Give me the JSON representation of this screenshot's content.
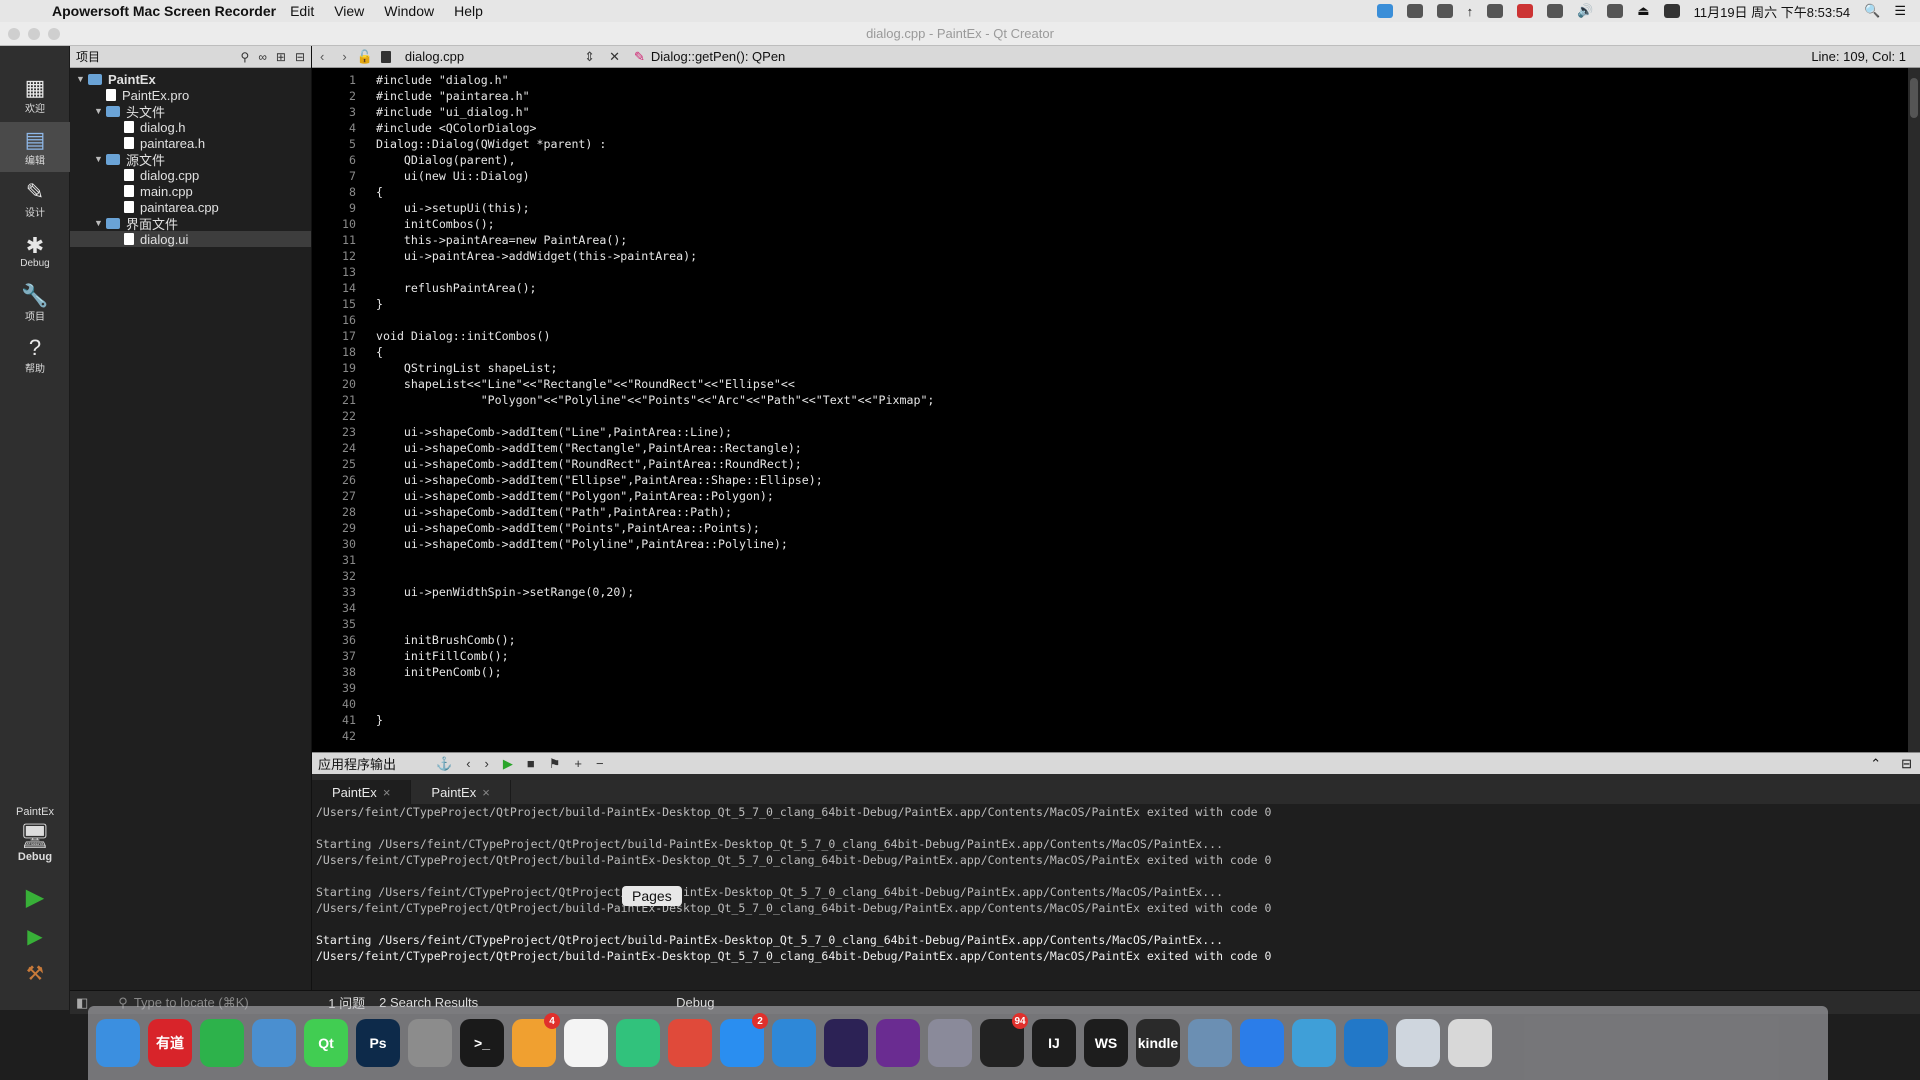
{
  "menubar": {
    "app_name": "Apowersoft Mac Screen Recorder",
    "items": [
      "Edit",
      "View",
      "Window",
      "Help"
    ],
    "clock": "11月19日 周六 下午8:53:54"
  },
  "window": {
    "title": "dialog.cpp - PaintEx - Qt Creator"
  },
  "modes": [
    {
      "label": "欢迎",
      "icon": "grid-icon"
    },
    {
      "label": "编辑",
      "icon": "document-icon"
    },
    {
      "label": "设计",
      "icon": "pencil-icon"
    },
    {
      "label": "Debug",
      "icon": "bug-icon"
    },
    {
      "label": "项目",
      "icon": "wrench-icon"
    },
    {
      "label": "帮助",
      "icon": "question-icon"
    }
  ],
  "project_panel": {
    "header": "项目",
    "tree": [
      {
        "label": "PaintEx",
        "type": "project",
        "indent": 0,
        "twisty": "▼"
      },
      {
        "label": "PaintEx.pro",
        "type": "file",
        "indent": 1,
        "twisty": ""
      },
      {
        "label": "头文件",
        "type": "folder",
        "indent": 1,
        "twisty": "▼"
      },
      {
        "label": "dialog.h",
        "type": "file",
        "indent": 2,
        "twisty": ""
      },
      {
        "label": "paintarea.h",
        "type": "file",
        "indent": 2,
        "twisty": ""
      },
      {
        "label": "源文件",
        "type": "folder",
        "indent": 1,
        "twisty": "▼"
      },
      {
        "label": "dialog.cpp",
        "type": "file",
        "indent": 2,
        "twisty": ""
      },
      {
        "label": "main.cpp",
        "type": "file",
        "indent": 2,
        "twisty": ""
      },
      {
        "label": "paintarea.cpp",
        "type": "file",
        "indent": 2,
        "twisty": ""
      },
      {
        "label": "界面文件",
        "type": "folder",
        "indent": 1,
        "twisty": "▼"
      },
      {
        "label": "dialog.ui",
        "type": "file",
        "indent": 2,
        "twisty": "",
        "selected": true
      }
    ]
  },
  "editor_toolbar": {
    "file_tab": "dialog.cpp",
    "function": "Dialog::getPen(): QPen",
    "line_col": "Line: 109, Col: 1"
  },
  "editor": {
    "lines": [
      "#include \"dialog.h\"",
      "#include \"paintarea.h\"",
      "#include \"ui_dialog.h\"",
      "#include <QColorDialog>",
      "Dialog::Dialog(QWidget *parent) :",
      "    QDialog(parent),",
      "    ui(new Ui::Dialog)",
      "{",
      "    ui->setupUi(this);",
      "    initCombos();",
      "    this->paintArea=new PaintArea();",
      "    ui->paintArea->addWidget(this->paintArea);",
      "",
      "    reflushPaintArea();",
      "}",
      "",
      "void Dialog::initCombos()",
      "{",
      "    QStringList shapeList;",
      "    shapeList<<\"Line\"<<\"Rectangle\"<<\"RoundRect\"<<\"Ellipse\"<<",
      "               \"Polygon\"<<\"Polyline\"<<\"Points\"<<\"Arc\"<<\"Path\"<<\"Text\"<<\"Pixmap\";",
      "",
      "    ui->shapeComb->addItem(\"Line\",PaintArea::Line);",
      "    ui->shapeComb->addItem(\"Rectangle\",PaintArea::Rectangle);",
      "    ui->shapeComb->addItem(\"RoundRect\",PaintArea::RoundRect);",
      "    ui->shapeComb->addItem(\"Ellipse\",PaintArea::Shape::Ellipse);",
      "    ui->shapeComb->addItem(\"Polygon\",PaintArea::Polygon);",
      "    ui->shapeComb->addItem(\"Path\",PaintArea::Path);",
      "    ui->shapeComb->addItem(\"Points\",PaintArea::Points);",
      "    ui->shapeComb->addItem(\"Polyline\",PaintArea::Polyline);",
      "",
      "",
      "    ui->penWidthSpin->setRange(0,20);",
      "",
      "",
      "    initBrushComb();",
      "    initFillComb();",
      "    initPenComb();",
      "",
      "",
      "}",
      ""
    ],
    "line_numbers": [
      "1",
      "2",
      "3",
      "4",
      "5",
      "6",
      "7",
      "8",
      "9",
      "10",
      "11",
      "12",
      "13",
      "14",
      "15",
      "16",
      "17",
      "18",
      "19",
      "20",
      "21",
      "22",
      "23",
      "24",
      "25",
      "26",
      "27",
      "28",
      "29",
      "30",
      "31",
      "32",
      "33",
      "34",
      "35",
      "36",
      "37",
      "38",
      "39",
      "40",
      "41",
      "42"
    ]
  },
  "output_pane": {
    "title": "应用程序输出",
    "tabs": [
      "PaintEx",
      "PaintEx"
    ],
    "lines": [
      {
        "text": "/Users/feint/CTypeProject/QtProject/build-PaintEx-Desktop_Qt_5_7_0_clang_64bit-Debug/PaintEx.app/Contents/MacOS/PaintEx exited with code 0",
        "bright": false
      },
      {
        "text": "",
        "bright": false
      },
      {
        "text": "Starting /Users/feint/CTypeProject/QtProject/build-PaintEx-Desktop_Qt_5_7_0_clang_64bit-Debug/PaintEx.app/Contents/MacOS/PaintEx...",
        "bright": false
      },
      {
        "text": "/Users/feint/CTypeProject/QtProject/build-PaintEx-Desktop_Qt_5_7_0_clang_64bit-Debug/PaintEx.app/Contents/MacOS/PaintEx exited with code 0",
        "bright": false
      },
      {
        "text": "",
        "bright": false
      },
      {
        "text": "Starting /Users/feint/CTypeProject/QtProject/build-PaintEx-Desktop_Qt_5_7_0_clang_64bit-Debug/PaintEx.app/Contents/MacOS/PaintEx...",
        "bright": false
      },
      {
        "text": "/Users/feint/CTypeProject/QtProject/build-PaintEx-Desktop_Qt_5_7_0_clang_64bit-Debug/PaintEx.app/Contents/MacOS/PaintEx exited with code 0",
        "bright": false
      },
      {
        "text": "",
        "bright": false
      },
      {
        "text": "Starting /Users/feint/CTypeProject/QtProject/build-PaintEx-Desktop_Qt_5_7_0_clang_64bit-Debug/PaintEx.app/Contents/MacOS/PaintEx...",
        "bright": true
      },
      {
        "text": "/Users/feint/CTypeProject/QtProject/build-PaintEx-Desktop_Qt_5_7_0_clang_64bit-Debug/PaintEx.app/Contents/MacOS/PaintEx exited with code 0",
        "bright": true
      }
    ]
  },
  "build_target": {
    "project": "PaintEx",
    "config": "Debug"
  },
  "statusbar": {
    "locate_placeholder": "Type to locate (⌘K)",
    "issues": "1 问题",
    "search_results": "2 Search Results",
    "debug_label": "Debug"
  },
  "dock": {
    "tooltip": "Pages",
    "pages_badge": "4",
    "qq_badge": "94",
    "appstore_badge": "2",
    "apps": [
      {
        "name": "finder",
        "label": "",
        "color": "#3b8fe0"
      },
      {
        "name": "youdao",
        "label": "有道",
        "color": "#d8242a"
      },
      {
        "name": "wechat",
        "label": "",
        "color": "#2db24b"
      },
      {
        "name": "xcode-tools",
        "label": "",
        "color": "#4a8fd0"
      },
      {
        "name": "qt-creator",
        "label": "Qt",
        "color": "#41cd52"
      },
      {
        "name": "photoshop",
        "label": "Ps",
        "color": "#0d2a4a"
      },
      {
        "name": "system-preferences",
        "label": "",
        "color": "#8c8c8c"
      },
      {
        "name": "terminal",
        "label": ">_",
        "color": "#1a1a1a"
      },
      {
        "name": "pages",
        "label": "",
        "color": "#f0a030"
      },
      {
        "name": "reminders",
        "label": "",
        "color": "#f4f4f4"
      },
      {
        "name": "qq-music",
        "label": "",
        "color": "#31c27c"
      },
      {
        "name": "chrome",
        "label": "",
        "color": "#e04a3a"
      },
      {
        "name": "app-store",
        "label": "",
        "color": "#2a8ef0"
      },
      {
        "name": "safari",
        "label": "",
        "color": "#2e88d8"
      },
      {
        "name": "eclipse",
        "label": "",
        "color": "#2c2255"
      },
      {
        "name": "github",
        "label": "",
        "color": "#6a2c91"
      },
      {
        "name": "launchpad",
        "label": "",
        "color": "#8a8a9a"
      },
      {
        "name": "qq",
        "label": "",
        "color": "#222"
      },
      {
        "name": "intellij",
        "label": "IJ",
        "color": "#1d1d1d"
      },
      {
        "name": "webstorm",
        "label": "WS",
        "color": "#1d1d1d"
      },
      {
        "name": "kindle",
        "label": "kindle",
        "color": "#2a2a2a"
      },
      {
        "name": "preview",
        "label": "",
        "color": "#6b8fb3"
      },
      {
        "name": "video-player",
        "label": "",
        "color": "#2b7de9"
      },
      {
        "name": "facetime",
        "label": "",
        "color": "#3f9fd8"
      },
      {
        "name": "vscode",
        "label": "",
        "color": "#2278c8"
      },
      {
        "name": "finder-window",
        "label": "",
        "color": "#cfd6de"
      },
      {
        "name": "trash",
        "label": "",
        "color": "#d8d8d8"
      }
    ]
  }
}
